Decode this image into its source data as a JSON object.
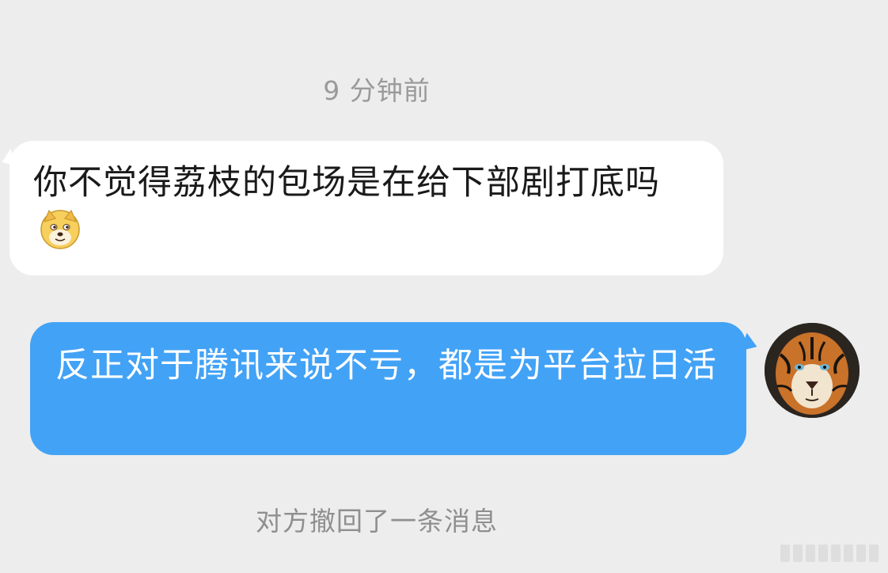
{
  "chat": {
    "timestamp": "9 分钟前",
    "incoming_message": {
      "text": "你不觉得荔枝的包场是在给下部剧打底吗",
      "emoji": "doge-emoji"
    },
    "outgoing_message": {
      "text": "反正对于腾讯来说不亏，都是为平台拉日活"
    },
    "avatar": "tiger-avatar",
    "system_notice": "对方撤回了一条消息"
  },
  "colors": {
    "background": "#ededed",
    "incoming_bubble": "#ffffff",
    "outgoing_bubble": "#42a2f6",
    "system_text": "#9a9a9a"
  }
}
